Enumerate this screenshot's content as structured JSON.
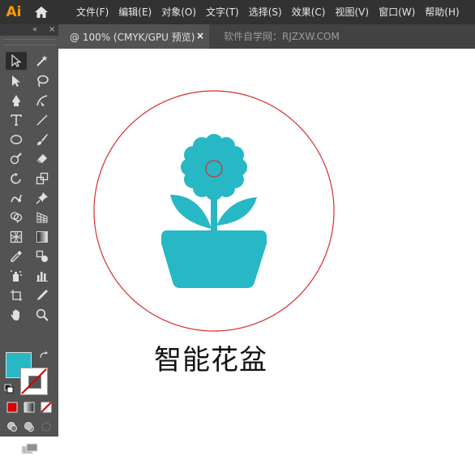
{
  "app": {
    "logo_text": "Ai"
  },
  "menu": {
    "items": [
      {
        "label": "文件(F)"
      },
      {
        "label": "编辑(E)"
      },
      {
        "label": "对象(O)"
      },
      {
        "label": "文字(T)"
      },
      {
        "label": "选择(S)"
      },
      {
        "label": "效果(C)"
      },
      {
        "label": "视图(V)"
      },
      {
        "label": "窗口(W)"
      },
      {
        "label": "帮助(H)"
      }
    ]
  },
  "document": {
    "tab_title": "@ 100% (CMYK/GPU 预览)",
    "tab_close": "×",
    "watermark": "软件自学网：RJZXW.COM"
  },
  "toolbar": {
    "collapse_glyph": "«",
    "close_glyph": "×",
    "fill_color": "#28b7c4",
    "stroke_color": "none"
  },
  "artwork": {
    "title": "智能花盆",
    "flower_color": "#28b7c4",
    "circle_color": "#d32f2f"
  }
}
